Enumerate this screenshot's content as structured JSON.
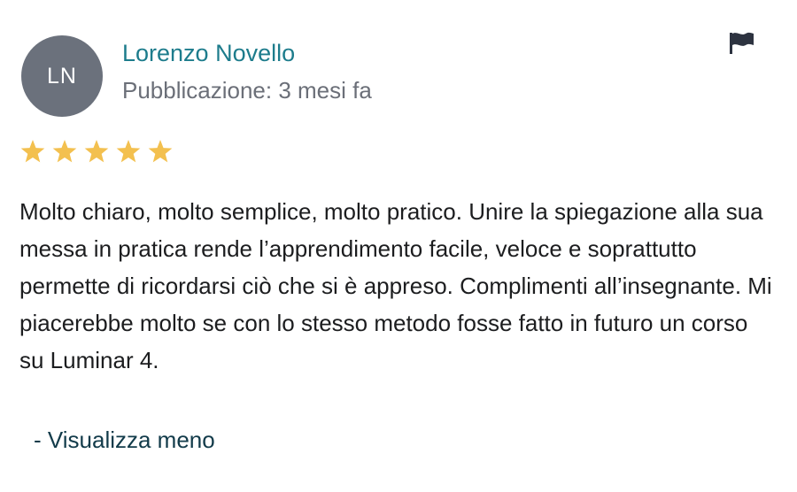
{
  "reviewer": {
    "initials": "LN",
    "name": "Lorenzo Novello",
    "published": "Pubblicazione: 3 mesi fa"
  },
  "rating": {
    "value": 5,
    "max": 5
  },
  "review": {
    "text": "Molto chiaro, molto semplice, molto pratico. Unire la spiegazione alla sua messa in pratica rende l’apprendimento facile, veloce e soprattutto permette di ricordarsi ciò che si è appreso. Complimenti all’insegnante. Mi piacerebbe molto se con lo stesso metodo fosse fatto in futuro un corso su Luminar 4.",
    "toggle_label": "- Visualizza meno"
  },
  "icons": {
    "report": "flag-icon",
    "star": "star-icon"
  },
  "colors": {
    "avatar_bg": "#6b717c",
    "name": "#1d7c8c",
    "meta": "#6b6f78",
    "star": "#f3c04f",
    "link": "#123b4a"
  }
}
